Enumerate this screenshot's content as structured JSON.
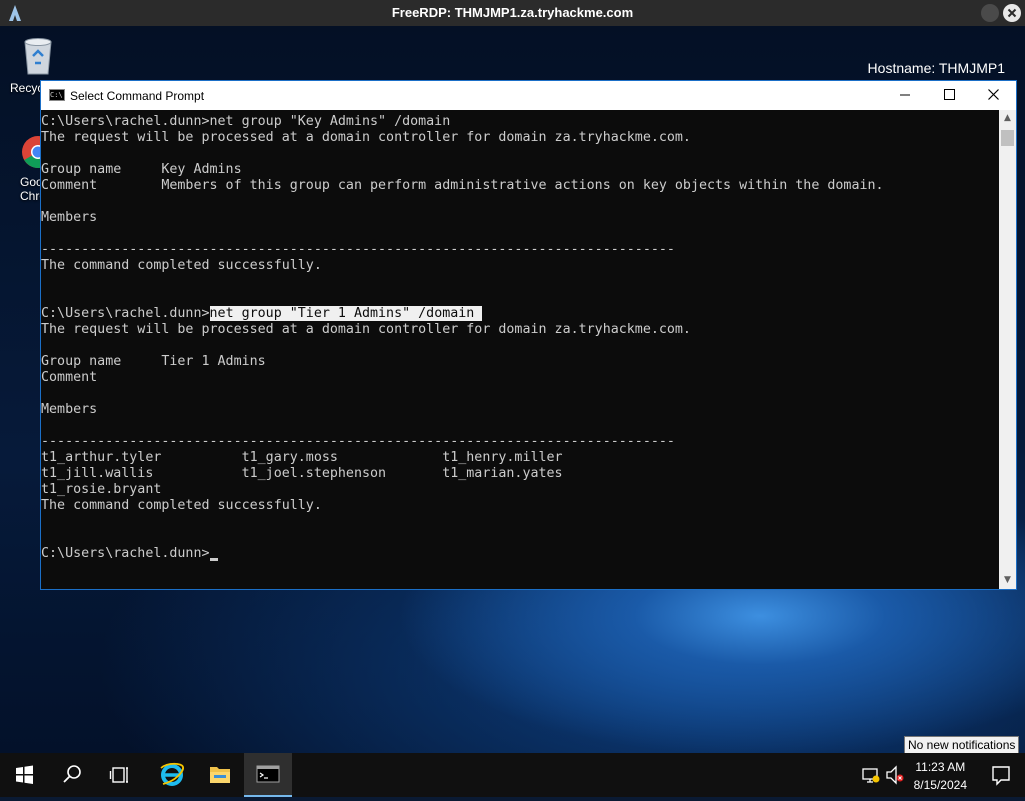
{
  "rdp": {
    "title": "FreeRDP: THMJMP1.za.tryhackme.com"
  },
  "desktop": {
    "hostname": "Hostname: THMJMP1",
    "icons": [
      {
        "label": "Recyc",
        "icon": "recycle-bin-icon"
      },
      {
        "label": "Goo Chro",
        "icon": "chrome-icon"
      }
    ]
  },
  "cmd": {
    "title": "Select Command Prompt",
    "lines": [
      "C:\\Users\\rachel.dunn>net group \"Key Admins\" /domain",
      "The request will be processed at a domain controller for domain za.tryhackme.com.",
      "",
      "Group name     Key Admins",
      "Comment        Members of this group can perform administrative actions on key objects within the domain.",
      "",
      "Members",
      "",
      "-------------------------------------------------------------------------------",
      "The command completed successfully.",
      "",
      "",
      "",
      "The request will be processed at a domain controller for domain za.tryhackme.com.",
      "",
      "Group name     Tier 1 Admins",
      "Comment",
      "",
      "Members",
      "",
      "-------------------------------------------------------------------------------",
      "t1_arthur.tyler          t1_gary.moss             t1_henry.miller",
      "t1_jill.wallis           t1_joel.stephenson       t1_marian.yates",
      "t1_rosie.bryant",
      "The command completed successfully.",
      "",
      "",
      ""
    ],
    "selected_prompt": "C:\\Users\\rachel.dunn>",
    "selected_command": "net group \"Tier 1 Admins\" /domain ",
    "final_prompt": "C:\\Users\\rachel.dunn>"
  },
  "taskbar": {
    "items": [
      "start-icon",
      "search-icon",
      "task-view-icon",
      "internet-explorer-icon",
      "file-explorer-icon",
      "command-prompt-icon"
    ],
    "time": "11:23 AM",
    "date": "8/15/2024",
    "tooltip": "No new notifications"
  }
}
